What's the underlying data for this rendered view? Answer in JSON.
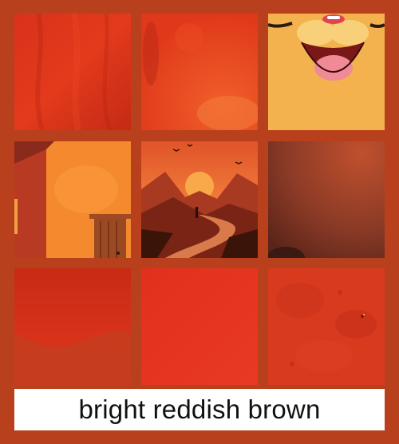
{
  "caption": "bright reddish brown",
  "colors": {
    "background": "#b8401c",
    "caption_background": "#ffffff",
    "caption_text": "#111111"
  },
  "swatches": [
    {
      "id": "red-fabric-swatch",
      "description_name": "red-fabric-texture"
    },
    {
      "id": "red-orange-painted-swatch",
      "description_name": "red-orange-painted-texture"
    },
    {
      "id": "cartoon-mouth-swatch",
      "description_name": "cartoon-cat-mouth"
    },
    {
      "id": "orange-house-door-swatch",
      "description_name": "orange-house-with-door"
    },
    {
      "id": "sunset-path-landscape-swatch",
      "description_name": "sunset-path-landscape"
    },
    {
      "id": "dark-brown-gradient-swatch",
      "description_name": "dark-brown-gradient"
    },
    {
      "id": "red-curve-swatch",
      "description_name": "red-curve-gradient"
    },
    {
      "id": "plain-red-swatch",
      "description_name": "plain-red"
    },
    {
      "id": "speckled-red-swatch",
      "description_name": "speckled-red-texture"
    }
  ]
}
